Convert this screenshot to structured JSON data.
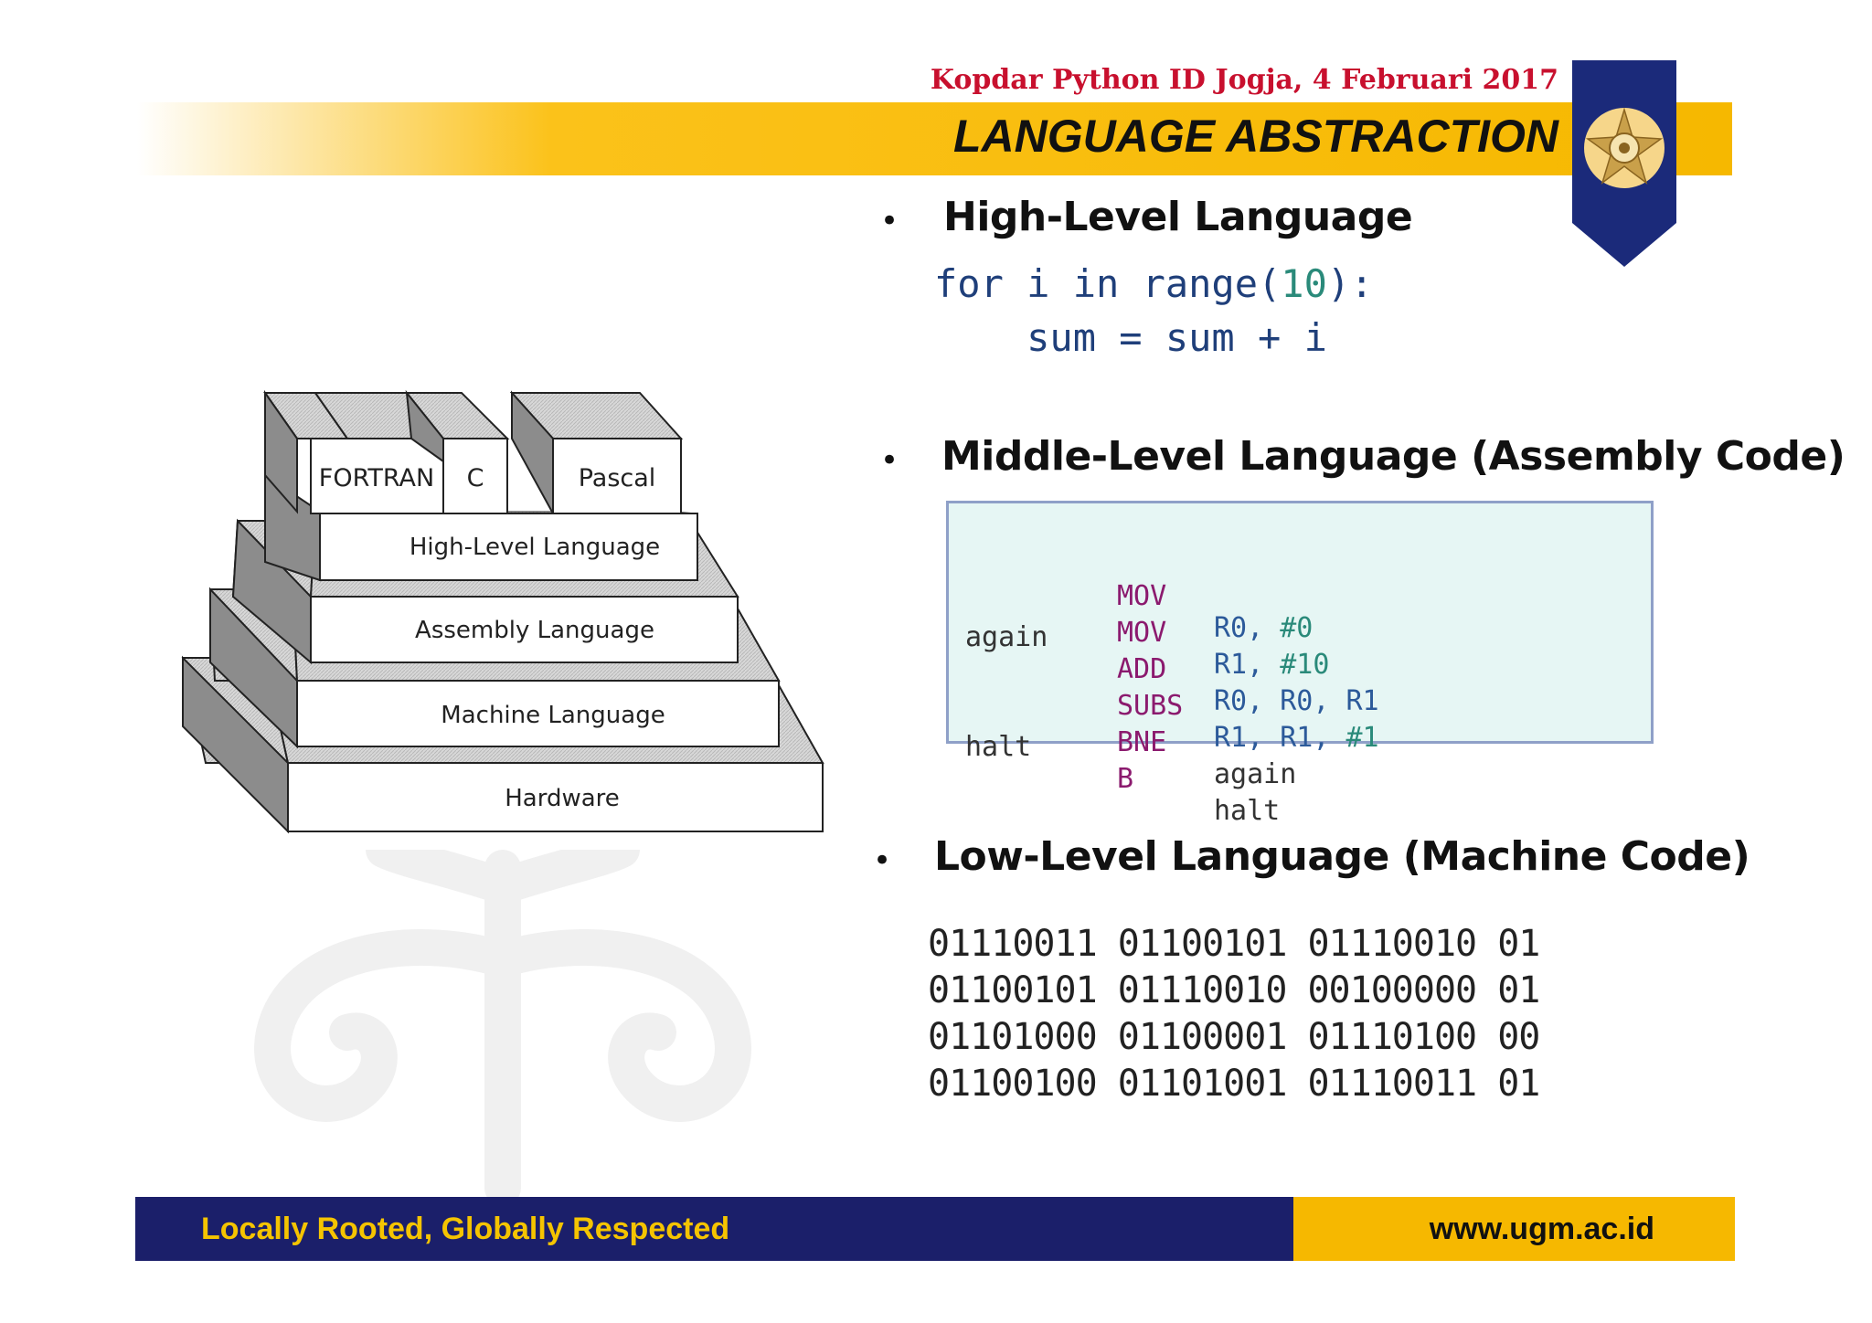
{
  "header": {
    "event": "Kopdar Python ID Jogja, 4 Februari 2017",
    "title": "LANGUAGE ABSTRACTION",
    "colors": {
      "gold": "#f6b800",
      "navy": "#1b1f6a",
      "red": "#c8102e"
    }
  },
  "diagram": {
    "languages": [
      "FORTRAN",
      "C",
      "Pascal"
    ],
    "layers": [
      "High-Level Language",
      "Assembly Language",
      "Machine Language",
      "Hardware"
    ]
  },
  "sections": {
    "high": {
      "bullet": "•",
      "title": "High-Level Language",
      "code": [
        {
          "kw": "for i in range(",
          "num": "10",
          "end": "):"
        },
        {
          "text": "    sum = sum + i"
        }
      ]
    },
    "middle": {
      "bullet": "•",
      "title": "Middle-Level Language (Assembly Code)",
      "code": [
        {
          "label": "",
          "op": "MOV",
          "args": "R0, ",
          "imm": "#0"
        },
        {
          "label": "",
          "op": "MOV",
          "args": "R1, ",
          "imm": "#10"
        },
        {
          "label": "again",
          "op": "ADD",
          "args": "R0, R0, R1",
          "imm": ""
        },
        {
          "label": "",
          "op": "SUBS",
          "args": "R1, R1, ",
          "imm": "#1"
        },
        {
          "label": "",
          "op": "BNE",
          "args": "again",
          "imm": ""
        },
        {
          "label": "halt",
          "op": "B",
          "args": "halt",
          "imm": ""
        }
      ]
    },
    "low": {
      "bullet": "•",
      "title": "Low-Level Language (Machine Code)",
      "code": [
        "01110011 01100101 01110010 01",
        "01100101 01110010 00100000 01",
        "01101000 01100001 01110100 00",
        "01100100 01101001 01110011 01"
      ]
    }
  },
  "footer": {
    "slogan": "Locally Rooted, Globally Respected",
    "url": "www.ugm.ac.id"
  }
}
